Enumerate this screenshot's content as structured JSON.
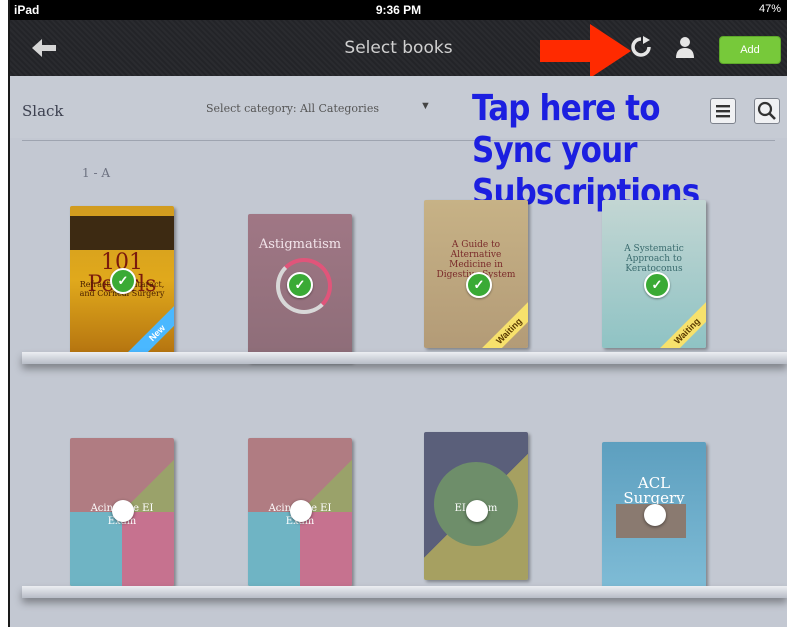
{
  "status_bar": {
    "device": "iPad",
    "time": "9:36 PM",
    "battery": "47%"
  },
  "nav": {
    "title": "Select books",
    "add_label": "Add"
  },
  "toolbar": {
    "section_title": "Slack",
    "category_label": "Select category:",
    "category_value": "All Categories"
  },
  "annotation": {
    "lines": [
      "Tap here to",
      "Sync your",
      "Subscriptions"
    ],
    "color": "#1c1fe0",
    "arrow_color": "#ff2a00"
  },
  "shelf_label": "1 - A",
  "books_row1": [
    {
      "title": "101 Pearls",
      "subtitle": "Refractive, Cataract, and Corneal Surgery",
      "ribbon": "New",
      "status": "selected"
    },
    {
      "title": "Astigmatism",
      "status": "downloading"
    },
    {
      "title": "A Guide to Alternative Medicine in Digestive System",
      "ribbon": "Waiting",
      "status": "selected"
    },
    {
      "title": "A Systematic Approach to Keratoconus",
      "ribbon": "Waiting",
      "status": "selected"
    }
  ],
  "books_row2": [
    {
      "title": "Acing the EI Exam",
      "status": "unselected"
    },
    {
      "title": "Acing the EI Exam",
      "status": "unselected"
    },
    {
      "title": "EI Exam",
      "status": "unselected"
    },
    {
      "title": "ACL Surgery",
      "status": "unselected"
    }
  ],
  "colors": {
    "add_button": "#77c93a",
    "check": "#3aaa35",
    "background": "#c3c8d2",
    "nav_bar": "#2a2b2f"
  }
}
